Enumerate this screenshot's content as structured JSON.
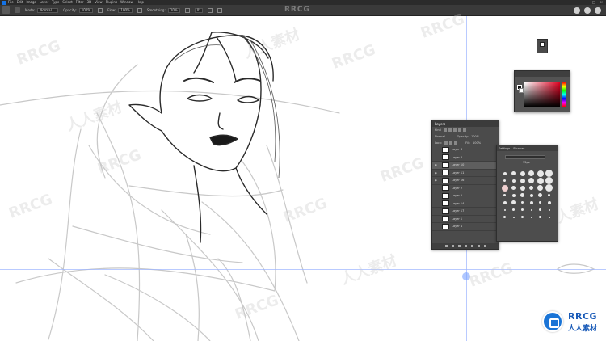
{
  "menubar": {
    "items": [
      "File",
      "Edit",
      "Image",
      "Layer",
      "Type",
      "Select",
      "Filter",
      "3D",
      "View",
      "Plugins",
      "Window",
      "Help"
    ]
  },
  "options": {
    "mode_label": "Mode:",
    "mode_value": "Normal",
    "opacity_label": "Opacity:",
    "opacity_value": "100%",
    "flow_label": "Flow:",
    "flow_value": "100%",
    "smoothing_label": "Smoothing:",
    "smoothing_value": "10%",
    "angle_value": "0°"
  },
  "watermark": {
    "top_text": "RRCG",
    "repeat_text": "RRCG",
    "cn_text": "人人素材"
  },
  "layers_panel": {
    "title": "Layers",
    "kind_label": "Kind",
    "blend_mode": "Normal",
    "opacity_label": "Opacity:",
    "opacity_value": "100%",
    "lock_label": "Lock:",
    "fill_label": "Fill:",
    "fill_value": "100%",
    "layers": [
      {
        "name": "Layer 8",
        "selected": false
      },
      {
        "name": "Layer 6",
        "selected": false
      },
      {
        "name": "Layer 10",
        "selected": true
      },
      {
        "name": "Layer 11",
        "selected": false
      },
      {
        "name": "Layer 16",
        "selected": false
      },
      {
        "name": "Layer 2",
        "selected": false
      },
      {
        "name": "Layer 5",
        "selected": false
      },
      {
        "name": "Layer 14",
        "selected": false
      },
      {
        "name": "Layer 17",
        "selected": false
      },
      {
        "name": "Layer 1",
        "selected": false
      },
      {
        "name": "Layer 4",
        "selected": false
      }
    ]
  },
  "brush_panel": {
    "tabs": [
      "Settings",
      "Brushes"
    ],
    "size_value": "75px"
  },
  "logo": {
    "line1": "RRCG",
    "line2": "人人素材"
  },
  "colors": {
    "guide": "#9bb3ff",
    "panel_bg": "#535353",
    "logo_blue": "#1a74d6"
  }
}
